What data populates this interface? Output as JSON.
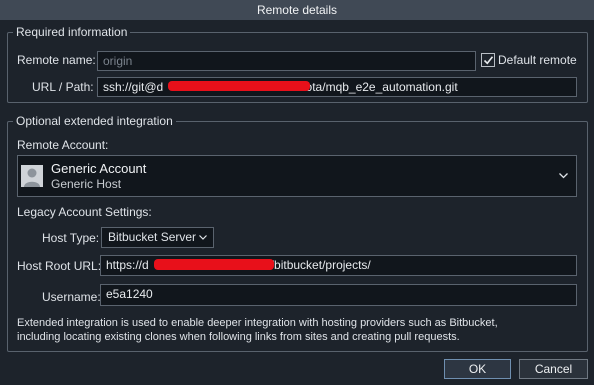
{
  "window": {
    "title": "Remote details"
  },
  "required": {
    "legend": "Required information",
    "remote_name_label": "Remote name:",
    "remote_name_value": "origin",
    "default_remote_label": "Default remote",
    "default_remote_checked": true,
    "url_label": "URL / Path:",
    "url_prefix": "ssh://git@d",
    "url_suffix": "/ota/mqb_e2e_automation.git"
  },
  "optional": {
    "legend": "Optional extended integration",
    "remote_account_label": "Remote Account:",
    "account_name": "Generic Account",
    "account_host": "Generic Host",
    "account_icon": "user-avatar-icon",
    "legacy_label": "Legacy Account Settings:",
    "host_type_label": "Host Type:",
    "host_type_value": "Bitbucket Server",
    "host_root_label": "Host Root URL:",
    "host_root_prefix": "https://d",
    "host_root_suffix": "/bitbucket/projects/",
    "username_label": "Username:",
    "username_value": "e5a1240",
    "note_line1": "Extended integration is used to enable deeper integration with hosting providers such as Bitbucket,",
    "note_line2": "including locating existing clones when following links from sites and creating pull requests."
  },
  "buttons": {
    "ok": "OK",
    "cancel": "Cancel"
  },
  "colors": {
    "redaction": "#e8101a",
    "background": "#1d232b",
    "title_bar": "#404955"
  }
}
